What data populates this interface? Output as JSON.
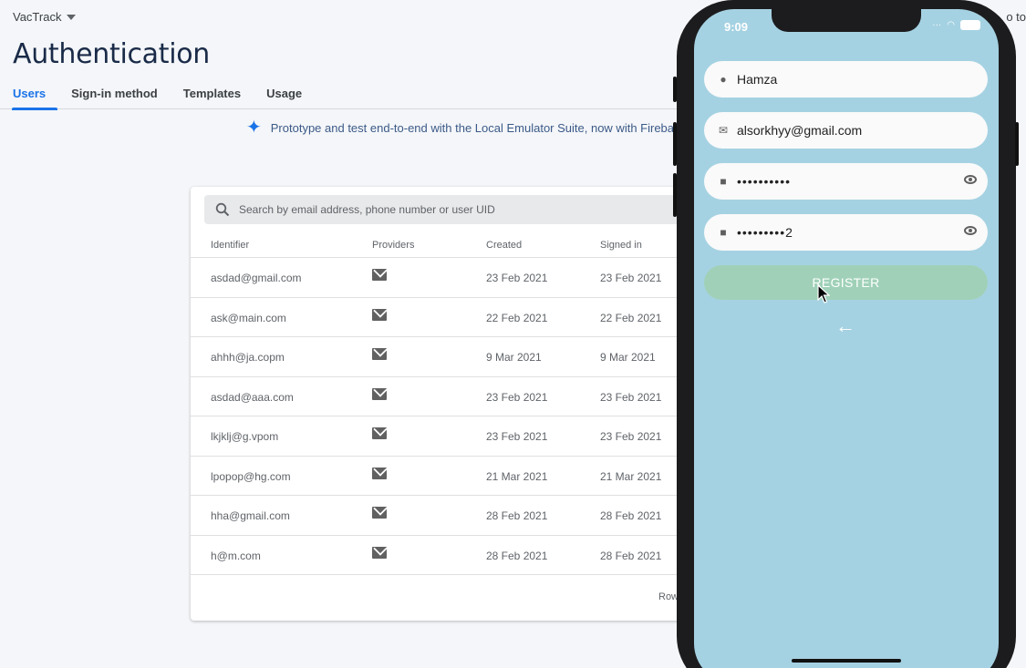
{
  "console": {
    "project_name": "VacTrack",
    "top_right_text": "o to",
    "page_title": "Authentication",
    "tabs": [
      "Users",
      "Sign-in method",
      "Templates",
      "Usage"
    ],
    "banner_text": "Prototype and test end-to-end with the Local Emulator Suite, now with Firebase",
    "search_placeholder": "Search by email address, phone number or user UID",
    "columns": [
      "Identifier",
      "Providers",
      "Created",
      "Signed in"
    ],
    "rows": [
      {
        "identifier": "asdad@gmail.com",
        "created": "23 Feb 2021",
        "signed_in": "23 Feb 2021"
      },
      {
        "identifier": "ask@main.com",
        "created": "22 Feb 2021",
        "signed_in": "22 Feb 2021"
      },
      {
        "identifier": "ahhh@ja.copm",
        "created": "9 Mar 2021",
        "signed_in": "9 Mar 2021"
      },
      {
        "identifier": "asdad@aaa.com",
        "created": "23 Feb 2021",
        "signed_in": "23 Feb 2021"
      },
      {
        "identifier": "lkjklj@g.vpom",
        "created": "23 Feb 2021",
        "signed_in": "23 Feb 2021"
      },
      {
        "identifier": "lpopop@hg.com",
        "created": "21 Mar 2021",
        "signed_in": "21 Mar 2021"
      },
      {
        "identifier": "hha@gmail.com",
        "created": "28 Feb 2021",
        "signed_in": "28 Feb 2021"
      },
      {
        "identifier": "h@m.com",
        "created": "28 Feb 2021",
        "signed_in": "28 Feb 2021"
      }
    ],
    "footer_text": "Row",
    "provider_icon": "mail-icon"
  },
  "phone": {
    "time": "9:09",
    "name_value": "Hamza",
    "email_value": "alsorkhyy@gmail.com",
    "password_value": "••••••••••",
    "confirm_value": "•••••••••2",
    "register_label": "REGISTER",
    "back_label": "←",
    "colors": {
      "screen_bg": "#a5d2e2",
      "register_bg": "#a0d1b8"
    }
  }
}
